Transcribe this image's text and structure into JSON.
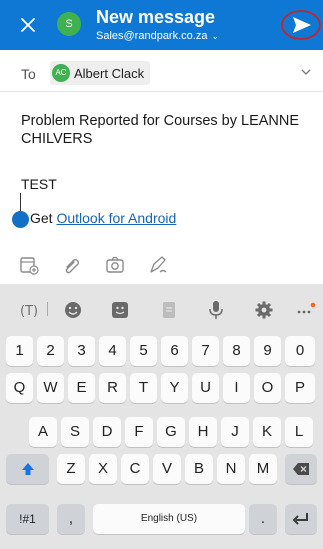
{
  "header": {
    "title": "New message",
    "from": "Sales@randpark.co.za",
    "avatar_letter": "S",
    "accent": "#0f78d4"
  },
  "to": {
    "label": "To",
    "recipient": "Albert Clack",
    "recipient_initials": "AC"
  },
  "message": {
    "subject": "Problem Reported for Courses by LEANNE CHILVERS",
    "body": "TEST",
    "signature_prefix": "Get ",
    "signature_link": "Outlook for Android"
  },
  "toolbar": {
    "icons": [
      "attach-file-icon",
      "paperclip-icon",
      "camera-icon",
      "pen-icon"
    ]
  },
  "keyboard": {
    "top_icons": [
      "translate-icon",
      "emoji-icon",
      "sticker-icon",
      "clipboard-icon",
      "mic-icon",
      "settings-icon",
      "more-icon"
    ],
    "row_numbers": [
      "1",
      "2",
      "3",
      "4",
      "5",
      "6",
      "7",
      "8",
      "9",
      "0"
    ],
    "row1": [
      "Q",
      "W",
      "E",
      "R",
      "T",
      "Y",
      "U",
      "I",
      "O",
      "P"
    ],
    "row2": [
      "A",
      "S",
      "D",
      "F",
      "G",
      "H",
      "J",
      "K",
      "L"
    ],
    "row3": [
      "Z",
      "X",
      "C",
      "V",
      "B",
      "N",
      "M"
    ],
    "symbols_label": "!#1",
    "comma_label": ",",
    "space_label": "English (US)",
    "period_label": "."
  }
}
